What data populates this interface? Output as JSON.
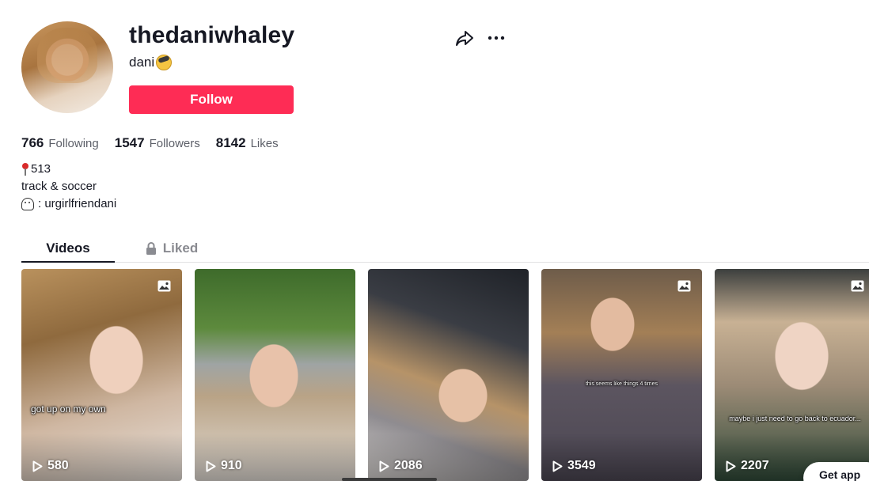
{
  "profile": {
    "username": "thedaniwhaley",
    "nickname": "dani",
    "follow_label": "Follow"
  },
  "stats": {
    "following_count": "766",
    "following_label": "Following",
    "followers_count": "1547",
    "followers_label": "Followers",
    "likes_count": "8142",
    "likes_label": "Likes"
  },
  "bio": {
    "line1": "513",
    "line2": "track & soccer",
    "line3": ": urgirlfriendani"
  },
  "tabs": {
    "videos_label": "Videos",
    "liked_label": "Liked"
  },
  "videos": [
    {
      "views": "580",
      "caption": "got up on my own"
    },
    {
      "views": "910",
      "caption": ""
    },
    {
      "views": "2086",
      "caption": ""
    },
    {
      "views": "3549",
      "caption": "this seems like things 4 times"
    },
    {
      "views": "2207",
      "caption": "maybe i just need to go back to ecuador..."
    }
  ],
  "get_app_label": "Get app",
  "colors": {
    "accent": "#fe2c55",
    "text": "#161823",
    "muted": "#5c5f68"
  }
}
